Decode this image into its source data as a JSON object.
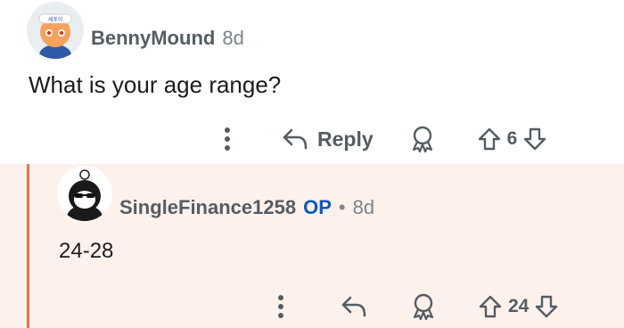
{
  "comments": [
    {
      "username": "BennyMound",
      "age": "8d",
      "body": "What is your age range?",
      "actions": {
        "reply_label": "Reply",
        "votes": "6"
      },
      "avatar_badge": "세포이"
    },
    {
      "username": "SingleFinance1258",
      "op_label": "OP",
      "separator": "•",
      "age": "8d",
      "body": "24-28",
      "actions": {
        "votes": "24"
      }
    }
  ],
  "icons": [
    "more-vertical-icon",
    "reply-arrow-icon",
    "award-icon",
    "upvote-icon",
    "downvote-icon"
  ],
  "colors": {
    "thread_line": "#e8773f",
    "highlight_bg": "#fdf1ec",
    "op": "#0a57c9",
    "muted": "#555d62"
  }
}
